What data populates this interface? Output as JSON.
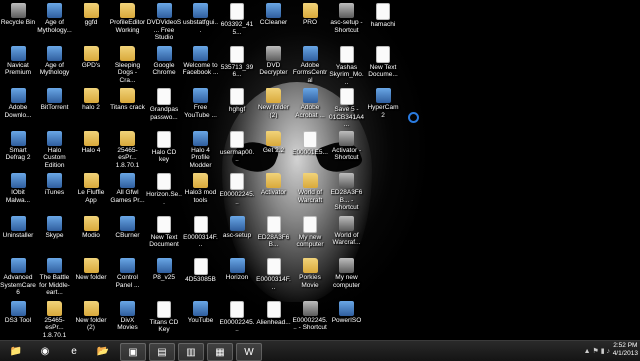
{
  "desktop": {
    "icons": [
      {
        "id": "recycle-bin",
        "label": "Recycle Bin",
        "kind": "exe",
        "col": 0,
        "row": 0
      },
      {
        "id": "age-of-mythology-1",
        "label": "Age of Mythology...",
        "kind": "app",
        "col": 1,
        "row": 0
      },
      {
        "id": "ggfd",
        "label": "ggfd",
        "kind": "folder",
        "col": 2,
        "row": 0
      },
      {
        "id": "profileeditor",
        "label": "ProfileEditor Working",
        "kind": "folder",
        "col": 3,
        "row": 0
      },
      {
        "id": "dvdvideosoft",
        "label": "DVDVideoS... Free Studio",
        "kind": "app",
        "col": 4,
        "row": 0
      },
      {
        "id": "usbstatfgui",
        "label": "usbstatfgui...",
        "kind": "app",
        "col": 5,
        "row": 0
      },
      {
        "id": "file-603392",
        "label": "603392_415...",
        "kind": "doc",
        "col": 6,
        "row": 0
      },
      {
        "id": "ccleaner",
        "label": "CCleaner",
        "kind": "app",
        "col": 7,
        "row": 0
      },
      {
        "id": "pro",
        "label": "PRO",
        "kind": "folder",
        "col": 8,
        "row": 0
      },
      {
        "id": "asc-setup-shortcut-1",
        "label": "asc-setup - Shortcut",
        "kind": "exe",
        "col": 9,
        "row": 0
      },
      {
        "id": "hamachi",
        "label": "hamachi",
        "kind": "doc",
        "col": 10,
        "row": 0
      },
      {
        "id": "navicat",
        "label": "Navicat Premium",
        "kind": "app",
        "col": 0,
        "row": 1
      },
      {
        "id": "age-of-mythology-2",
        "label": "Age of Mythology",
        "kind": "app",
        "col": 1,
        "row": 1
      },
      {
        "id": "gpds",
        "label": "GPD's",
        "kind": "folder",
        "col": 2,
        "row": 1
      },
      {
        "id": "sleeping-dogs",
        "label": "Sleeping Dogs - Cra...",
        "kind": "folder",
        "col": 3,
        "row": 1
      },
      {
        "id": "google-chrome",
        "label": "Google Chrome",
        "kind": "app",
        "col": 4,
        "row": 1
      },
      {
        "id": "welcome-facebook",
        "label": "Welcome to Facebook ...",
        "kind": "app",
        "col": 5,
        "row": 1
      },
      {
        "id": "file-535713",
        "label": "535713_396...",
        "kind": "doc",
        "col": 6,
        "row": 1
      },
      {
        "id": "dvd-decrypter",
        "label": "DVD Decrypter",
        "kind": "exe",
        "col": 7,
        "row": 1
      },
      {
        "id": "adobe-formscentral",
        "label": "Adobe FormsCentral",
        "kind": "app",
        "col": 8,
        "row": 1
      },
      {
        "id": "yashas-skyrim",
        "label": "Yashas Skyrim_Mo...",
        "kind": "doc",
        "col": 9,
        "row": 1
      },
      {
        "id": "new-text-doc-1",
        "label": "New Text Docume...",
        "kind": "doc",
        "col": 10,
        "row": 1
      },
      {
        "id": "adobe-download",
        "label": "Adobe Downlo...",
        "kind": "app",
        "col": 0,
        "row": 2
      },
      {
        "id": "bittorrent",
        "label": "BitTorrent",
        "kind": "app",
        "col": 1,
        "row": 2
      },
      {
        "id": "halo-2",
        "label": "halo 2",
        "kind": "folder",
        "col": 2,
        "row": 2
      },
      {
        "id": "titans-crack",
        "label": "Titans crack",
        "kind": "folder",
        "col": 3,
        "row": 2
      },
      {
        "id": "grandpas-password",
        "label": "Grandpas passwo...",
        "kind": "doc",
        "col": 4,
        "row": 2
      },
      {
        "id": "free-youtube",
        "label": "Free YouTube ...",
        "kind": "app",
        "col": 5,
        "row": 2
      },
      {
        "id": "hghgf",
        "label": "hghgf",
        "kind": "doc",
        "col": 6,
        "row": 2
      },
      {
        "id": "new-folder-2",
        "label": "New folder (2)",
        "kind": "folder",
        "col": 7,
        "row": 2
      },
      {
        "id": "adobe-acrobat",
        "label": "Adobe Acrobat ...",
        "kind": "app",
        "col": 8,
        "row": 2
      },
      {
        "id": "save-5",
        "label": "Save 5 - 01CB341A4...",
        "kind": "doc",
        "col": 9,
        "row": 2
      },
      {
        "id": "hypercam2",
        "label": "HyperCam 2",
        "kind": "app",
        "col": 10,
        "row": 2
      },
      {
        "id": "smart-defrag",
        "label": "Smart Defrag 2",
        "kind": "app",
        "col": 0,
        "row": 3
      },
      {
        "id": "halo-custom-edition",
        "label": "Halo Custom Edition",
        "kind": "app",
        "col": 1,
        "row": 3
      },
      {
        "id": "halo-4",
        "label": "Halo 4",
        "kind": "folder",
        "col": 2,
        "row": 3
      },
      {
        "id": "file-25465-1",
        "label": "25465-esPr... 1.8.70.1",
        "kind": "folder",
        "col": 3,
        "row": 3
      },
      {
        "id": "halo-cd-key",
        "label": "Halo CD key",
        "kind": "doc",
        "col": 4,
        "row": 3
      },
      {
        "id": "halo-4-profile-modder",
        "label": "Halo 4 Profile Modder",
        "kind": "app",
        "col": 5,
        "row": 3
      },
      {
        "id": "usermap00",
        "label": "usermap00...",
        "kind": "doc",
        "col": 6,
        "row": 3
      },
      {
        "id": "get-2",
        "label": "Get 2.2",
        "kind": "folder",
        "col": 7,
        "row": 3
      },
      {
        "id": "e00001e5",
        "label": "E00001E5...",
        "kind": "doc",
        "col": 8,
        "row": 3
      },
      {
        "id": "activator-shortcut",
        "label": "Activator - Shortcut",
        "kind": "exe",
        "col": 9,
        "row": 3
      },
      {
        "id": "iobit-malware",
        "label": "IObit Malwa...",
        "kind": "app",
        "col": 0,
        "row": 4
      },
      {
        "id": "itunes",
        "label": "iTunes",
        "kind": "app",
        "col": 1,
        "row": 4
      },
      {
        "id": "le-fluffie-app",
        "label": "Le Fluffie App",
        "kind": "folder",
        "col": 2,
        "row": 4
      },
      {
        "id": "all-gfwl-games",
        "label": "All Gfwl Games Pr...",
        "kind": "app",
        "col": 3,
        "row": 4
      },
      {
        "id": "horizon-se",
        "label": "Horizon.Se...",
        "kind": "doc",
        "col": 4,
        "row": 4
      },
      {
        "id": "halo3-mod-tools",
        "label": "Halo3 mod tools",
        "kind": "folder",
        "col": 5,
        "row": 4
      },
      {
        "id": "e00002245-1",
        "label": "E00002245...",
        "kind": "doc",
        "col": 6,
        "row": 4
      },
      {
        "id": "activator",
        "label": "Activator",
        "kind": "folder",
        "col": 7,
        "row": 4
      },
      {
        "id": "world-of-warcraft-1",
        "label": "World of Warcraft",
        "kind": "folder",
        "col": 8,
        "row": 4
      },
      {
        "id": "ed28a3f6b-shortcut",
        "label": "ED28A3F6B... - Shortcut",
        "kind": "exe",
        "col": 9,
        "row": 4
      },
      {
        "id": "uninstaller",
        "label": "Uninstaller",
        "kind": "app",
        "col": 0,
        "row": 5
      },
      {
        "id": "skype",
        "label": "Skype",
        "kind": "app",
        "col": 1,
        "row": 5
      },
      {
        "id": "modio",
        "label": "Modio",
        "kind": "folder",
        "col": 2,
        "row": 5
      },
      {
        "id": "cburner",
        "label": "CBurner",
        "kind": "app",
        "col": 3,
        "row": 5
      },
      {
        "id": "new-text-document",
        "label": "New Text Document",
        "kind": "doc",
        "col": 4,
        "row": 5
      },
      {
        "id": "e0000314f-1",
        "label": "E0000314F...",
        "kind": "doc",
        "col": 5,
        "row": 5
      },
      {
        "id": "asc-setup",
        "label": "asc-setup",
        "kind": "app",
        "col": 6,
        "row": 5
      },
      {
        "id": "ed28a3f6b",
        "label": "ED28A3F6B...",
        "kind": "doc",
        "col": 7,
        "row": 5
      },
      {
        "id": "my-new-computer-1",
        "label": "My new computer",
        "kind": "doc",
        "col": 8,
        "row": 5
      },
      {
        "id": "world-of-warcraft-2",
        "label": "World of Warcraf...",
        "kind": "exe",
        "col": 9,
        "row": 5
      },
      {
        "id": "advanced-systemcare",
        "label": "Advanced SystemCare 6",
        "kind": "app",
        "col": 0,
        "row": 6
      },
      {
        "id": "battle-middle-earth",
        "label": "The Battle for Middle-eart...",
        "kind": "app",
        "col": 1,
        "row": 6
      },
      {
        "id": "new-folder",
        "label": "New folder",
        "kind": "folder",
        "col": 2,
        "row": 6
      },
      {
        "id": "control-panel",
        "label": "Control Panel ...",
        "kind": "app",
        "col": 3,
        "row": 6
      },
      {
        "id": "p8-v25",
        "label": "P8_v25",
        "kind": "app",
        "col": 4,
        "row": 6
      },
      {
        "id": "file-4d53085b",
        "label": "4D53085B",
        "kind": "doc",
        "col": 5,
        "row": 6
      },
      {
        "id": "horizon",
        "label": "Horizon",
        "kind": "app",
        "col": 6,
        "row": 6
      },
      {
        "id": "e0000314f-2",
        "label": "E0000314F...",
        "kind": "doc",
        "col": 7,
        "row": 6
      },
      {
        "id": "porkies-movie",
        "label": "Porkies Movie",
        "kind": "folder",
        "col": 8,
        "row": 6
      },
      {
        "id": "my-new-computer-2",
        "label": "My new computer",
        "kind": "exe",
        "col": 9,
        "row": 6
      },
      {
        "id": "ds3-tool",
        "label": "DS3 Tool",
        "kind": "app",
        "col": 0,
        "row": 7
      },
      {
        "id": "file-25465-2",
        "label": "25465-esPr... 1.8.70.1",
        "kind": "folder",
        "col": 1,
        "row": 7
      },
      {
        "id": "new-folder-2b",
        "label": "New folder (2)",
        "kind": "folder",
        "col": 2,
        "row": 7
      },
      {
        "id": "divx-movies",
        "label": "DivX Movies",
        "kind": "app",
        "col": 3,
        "row": 7
      },
      {
        "id": "titans-cd-key",
        "label": "Titans CD Key",
        "kind": "doc",
        "col": 4,
        "row": 7
      },
      {
        "id": "youtube",
        "label": "YouTube",
        "kind": "app",
        "col": 5,
        "row": 7
      },
      {
        "id": "e00002245-2",
        "label": "E00002245...",
        "kind": "doc",
        "col": 6,
        "row": 7
      },
      {
        "id": "alienhead",
        "label": "Alienhead...",
        "kind": "doc",
        "col": 7,
        "row": 7
      },
      {
        "id": "e00002245-shortcut",
        "label": "E00002245... - Shortcut",
        "kind": "exe",
        "col": 8,
        "row": 7
      },
      {
        "id": "poweriso",
        "label": "PowerISO",
        "kind": "app",
        "col": 9,
        "row": 7
      }
    ]
  },
  "taskbar": {
    "items": [
      {
        "id": "file-explorer",
        "icon": "folder-icon",
        "glyph": "📁",
        "active": false
      },
      {
        "id": "chrome",
        "icon": "chrome-icon",
        "glyph": "◉",
        "active": false
      },
      {
        "id": "internet-explorer",
        "icon": "internet-explorer-icon",
        "glyph": "e",
        "active": false
      },
      {
        "id": "explorer-2",
        "icon": "folder-icon",
        "glyph": "📂",
        "active": false
      },
      {
        "id": "cmd",
        "icon": "command-prompt-icon",
        "glyph": "▣",
        "active": true
      },
      {
        "id": "app-1",
        "icon": "app-icon",
        "glyph": "▤",
        "active": true
      },
      {
        "id": "app-2",
        "icon": "app-icon",
        "glyph": "▥",
        "active": true
      },
      {
        "id": "app-3",
        "icon": "app-icon",
        "glyph": "▦",
        "active": true
      },
      {
        "id": "wow",
        "icon": "world-of-warcraft-icon",
        "glyph": "W",
        "active": true
      }
    ],
    "tray": {
      "icons": "▲ ⚑ ▮ ♪",
      "time": "2:52 PM",
      "date": "4/1/2013"
    }
  },
  "colors": {
    "desktop_bg": "#000000",
    "taskbar_bg": "#1e1e1e",
    "loading_spinner": "#2a7be0"
  }
}
